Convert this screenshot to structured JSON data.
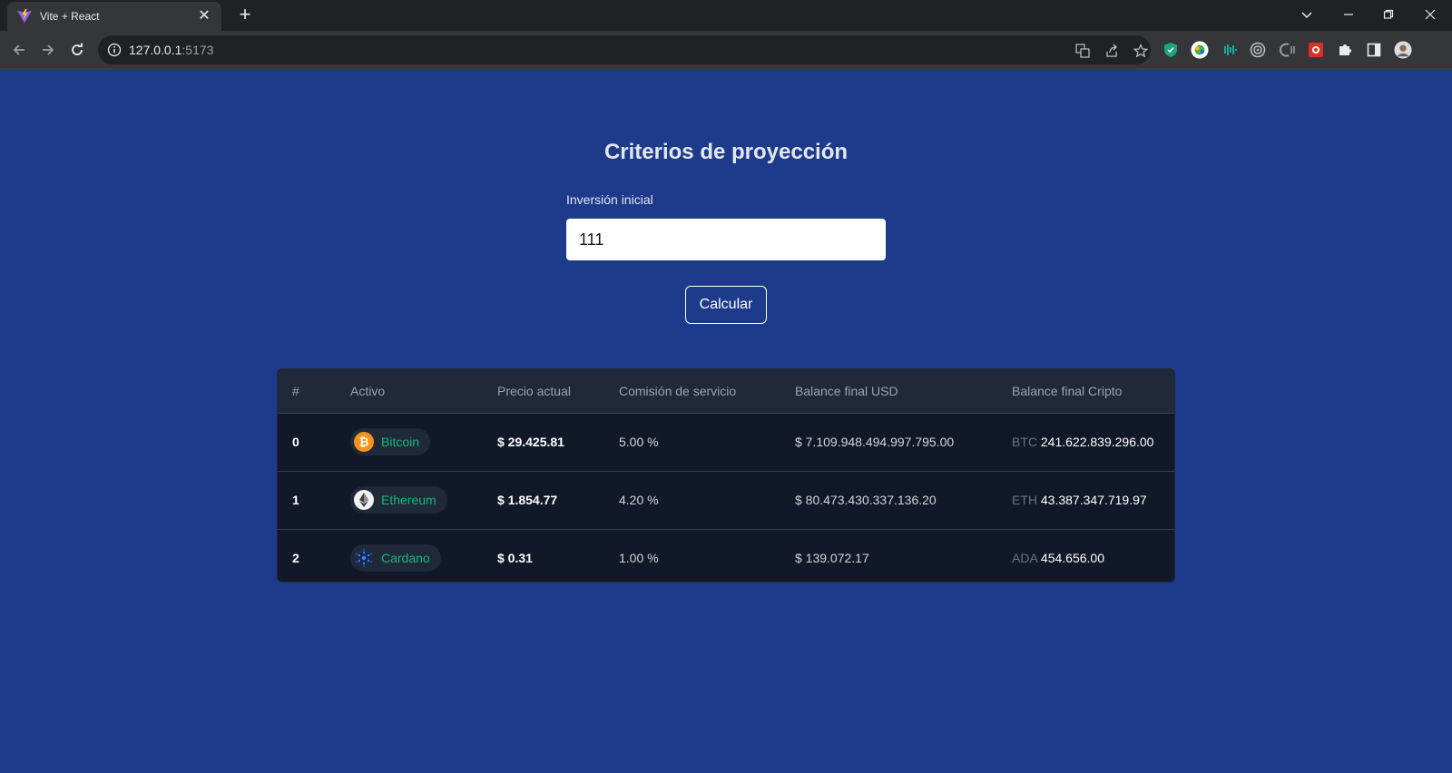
{
  "browser": {
    "tab_title": "Vite + React",
    "url_host": "127.0.0.1",
    "url_port": ":5173"
  },
  "form": {
    "title": "Criterios de proyección",
    "investment_label": "Inversión inicial",
    "investment_value": "111",
    "calculate_label": "Calcular"
  },
  "table": {
    "headers": [
      "#",
      "Activo",
      "Precio actual",
      "Comisión de servicio",
      "Balance final USD",
      "Balance final Cripto"
    ],
    "rows": [
      {
        "index": "0",
        "asset": "Bitcoin",
        "icon": "bitcoin-icon",
        "price": "$ 29.425.81",
        "fee": "5.00 %",
        "balance_usd": "$ 7.109.948.494.997.795.00",
        "symbol": "BTC",
        "balance_crypto": "241.622.839.296.00"
      },
      {
        "index": "1",
        "asset": "Ethereum",
        "icon": "ethereum-icon",
        "price": "$ 1.854.77",
        "fee": "4.20 %",
        "balance_usd": "$ 80.473.430.337.136.20",
        "symbol": "ETH",
        "balance_crypto": "43.387.347.719.97"
      },
      {
        "index": "2",
        "asset": "Cardano",
        "icon": "cardano-icon",
        "price": "$ 0.31",
        "fee": "1.00 %",
        "balance_usd": "$ 139.072.17",
        "symbol": "ADA",
        "balance_crypto": "454.656.00"
      }
    ]
  },
  "colors": {
    "page_bg": "#1e3a8a",
    "table_bg": "#111827",
    "asset_accent": "#10b981"
  }
}
